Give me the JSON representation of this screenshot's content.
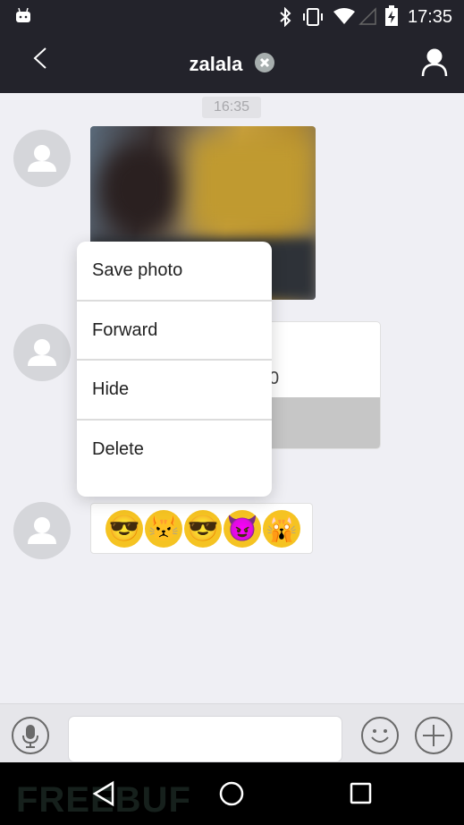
{
  "status_bar": {
    "time": "17:35",
    "icons": [
      "android-debug-icon",
      "bluetooth-icon",
      "vibrate-icon",
      "wifi-icon",
      "cell-signal-icon",
      "battery-charging-icon"
    ]
  },
  "header": {
    "title": "zalala",
    "clear_icon": "close-circle-icon",
    "back_icon": "chevron-left-icon",
    "profile_icon": "person-icon"
  },
  "chat": {
    "timestamp": "16:35",
    "card_partial_text": "0",
    "emojis": [
      "😎",
      "😾",
      "😎",
      "😈",
      "🙀"
    ]
  },
  "context_menu": {
    "items": [
      "Save photo",
      "Forward",
      "Hide",
      "Delete"
    ]
  },
  "input_bar": {
    "message_value": "",
    "voice_icon": "microphone-icon",
    "emoji_icon": "smiley-icon",
    "add_icon": "plus-icon"
  },
  "watermark": "FREEBUF",
  "colors": {
    "header_bg": "#23232b",
    "chat_bg": "#efeff4"
  }
}
